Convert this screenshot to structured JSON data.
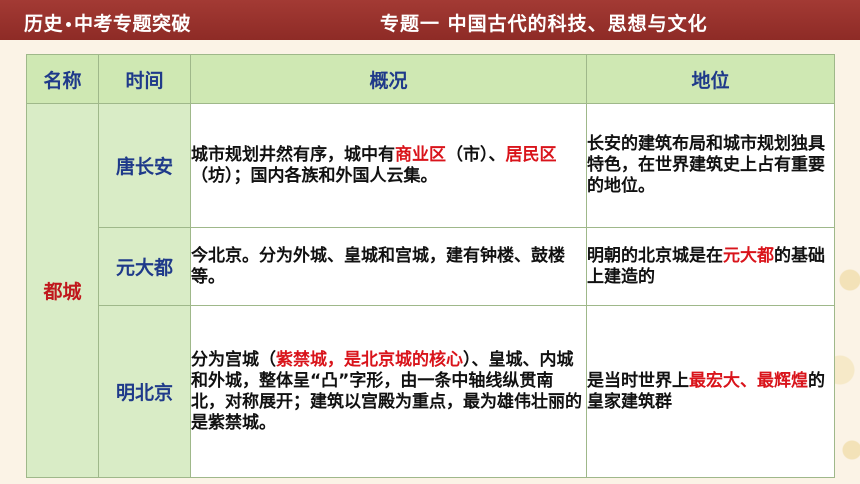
{
  "header": {
    "left_part1": "历史",
    "left_part2": "中考专题突破",
    "right": "专题一  中国古代的科技、思想与文化"
  },
  "table": {
    "headers": [
      "名称",
      "时间",
      "概况",
      "地位"
    ],
    "group_label": "都城",
    "rows": [
      {
        "name": "唐长安",
        "overview": [
          {
            "t": "城市规划井然有序，城中有",
            "red": false
          },
          {
            "t": "商业区",
            "red": true
          },
          {
            "t": "（市）、",
            "red": false
          },
          {
            "t": "居民区",
            "red": true
          },
          {
            "t": "（坊）；国内各族和外国人云集。",
            "red": false
          }
        ],
        "status": [
          {
            "t": "长安的建筑布局和城市规划独具特色，在世界建筑史上占有重要的地位。",
            "red": false
          }
        ]
      },
      {
        "name": "元大都",
        "overview": [
          {
            "t": "今北京。分为外城、皇城和宫城，建有钟楼、鼓楼等。",
            "red": false
          }
        ],
        "status": [
          {
            "t": "明朝的北京城是在",
            "red": false
          },
          {
            "t": "元大都",
            "red": true
          },
          {
            "t": "的基础上建造的",
            "red": false
          }
        ]
      },
      {
        "name": "明北京",
        "overview": [
          {
            "t": "分为宫城（",
            "red": false
          },
          {
            "t": "紫禁城，是北京城的核心",
            "red": true
          },
          {
            "t": "）、皇城、内城和外城，整体呈“凸”字形，由一条中轴线纵贯南北，对称展开；建筑以宫殿为重点，最为雄伟壮丽的是紫禁城。",
            "red": false
          }
        ],
        "status": [
          {
            "t": "是当时世界上",
            "red": false
          },
          {
            "t": "最宏大、最辉煌",
            "red": true
          },
          {
            "t": "的皇家建筑群",
            "red": false
          }
        ]
      }
    ]
  }
}
